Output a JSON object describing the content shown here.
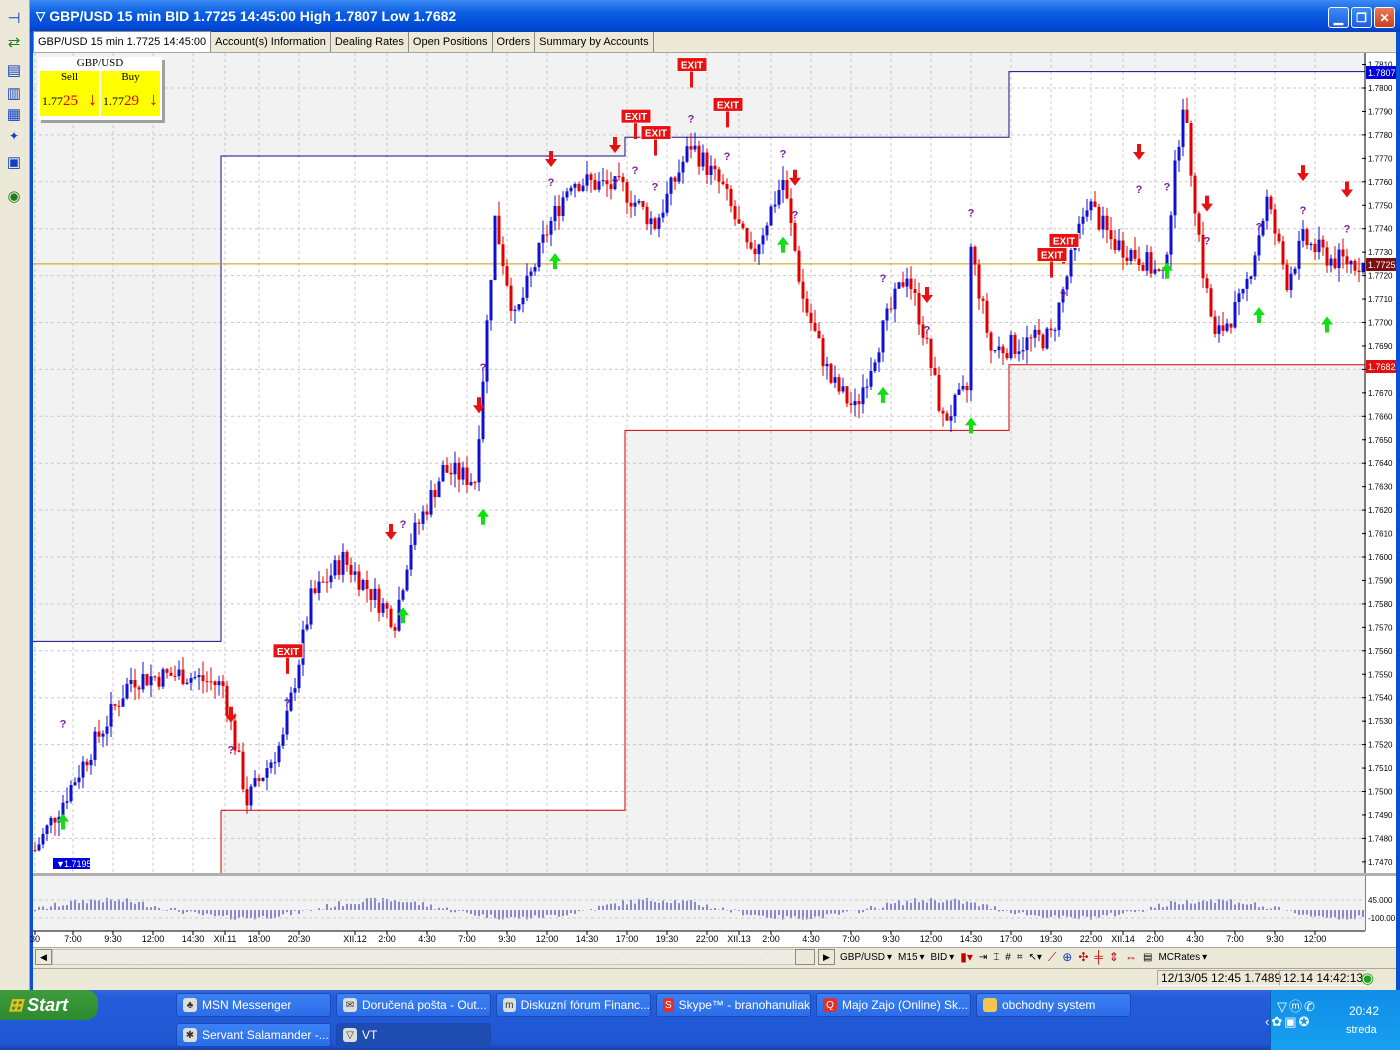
{
  "window": {
    "title": "GBP/USD 15 min BID 1.7725 14:45:00 High 1.7807 Low 1.7682",
    "controls": [
      "minimize",
      "maximize",
      "close"
    ]
  },
  "tabs": [
    {
      "label": "GBP/USD 15 min 1.7725 14:45:00",
      "active": true
    },
    {
      "label": "Account(s) Information"
    },
    {
      "label": "Dealing Rates"
    },
    {
      "label": "Open Positions"
    },
    {
      "label": "Orders"
    },
    {
      "label": "Summary by Accounts"
    }
  ],
  "quote": {
    "symbol": "GBP/USD",
    "sell_label": "Sell",
    "buy_label": "Buy",
    "sell_prefix": "1.77",
    "sell_pips": "25",
    "buy_prefix": "1.77",
    "buy_pips": "29",
    "arrow": "↓"
  },
  "left_toolbar": [
    "pin-icon",
    "swap-icon",
    "layout-rows-icon",
    "layout-cols-icon",
    "layout-grid-icon",
    "new-chart-icon",
    "print-icon",
    "connection-icon"
  ],
  "chart_data": {
    "type": "candlestick",
    "symbol": "GBP/USD",
    "timeframe": "15 min",
    "side": "BID",
    "ylim": [
      1.7465,
      1.7815
    ],
    "yticks": [
      1.781,
      1.78,
      1.779,
      1.778,
      1.777,
      1.776,
      1.775,
      1.774,
      1.773,
      1.772,
      1.771,
      1.77,
      1.769,
      1.768,
      1.767,
      1.766,
      1.765,
      1.764,
      1.763,
      1.762,
      1.761,
      1.76,
      1.759,
      1.758,
      1.757,
      1.756,
      1.755,
      1.754,
      1.753,
      1.752,
      1.751,
      1.75,
      1.749,
      1.748,
      1.747
    ],
    "price_flags": {
      "high": "1.7807",
      "current": "1.7725",
      "low": "1.7682",
      "min_label": "1.7195"
    },
    "current_price": 1.7725,
    "colors": {
      "up": "#1010d0",
      "down": "#e00000",
      "resistance": "#101080",
      "support": "#d00000",
      "current_line": "#c8a000"
    },
    "close_path": [
      [
        0,
        1.7475
      ],
      [
        7,
        1.7496
      ],
      [
        14,
        1.7518
      ],
      [
        24,
        1.7548
      ],
      [
        37,
        1.755
      ],
      [
        47,
        1.7545
      ],
      [
        53,
        1.7496
      ],
      [
        62,
        1.7522
      ],
      [
        69,
        1.7582
      ],
      [
        77,
        1.7599
      ],
      [
        90,
        1.7573
      ],
      [
        94,
        1.7607
      ],
      [
        102,
        1.7637
      ],
      [
        110,
        1.7633
      ],
      [
        115,
        1.7744
      ],
      [
        120,
        1.7701
      ],
      [
        128,
        1.7739
      ],
      [
        134,
        1.7761
      ],
      [
        147,
        1.7757
      ],
      [
        155,
        1.7742
      ],
      [
        164,
        1.7776
      ],
      [
        172,
        1.7757
      ],
      [
        179,
        1.7727
      ],
      [
        187,
        1.7761
      ],
      [
        192,
        1.771
      ],
      [
        199,
        1.7675
      ],
      [
        205,
        1.7663
      ],
      [
        212,
        1.7697
      ],
      [
        218,
        1.7722
      ],
      [
        222,
        1.7697
      ],
      [
        227,
        1.7658
      ],
      [
        233,
        1.7671
      ],
      [
        234,
        1.7731
      ],
      [
        239,
        1.7688
      ],
      [
        254,
        1.7694
      ],
      [
        263,
        1.7752
      ],
      [
        269,
        1.7735
      ],
      [
        277,
        1.7727
      ],
      [
        282,
        1.7718
      ],
      [
        287,
        1.7795
      ],
      [
        292,
        1.7722
      ],
      [
        295,
        1.7693
      ],
      [
        302,
        1.771
      ],
      [
        308,
        1.7752
      ],
      [
        313,
        1.7718
      ],
      [
        317,
        1.7735
      ],
      [
        324,
        1.7727
      ],
      [
        332,
        1.7725
      ]
    ],
    "resistance_steps": [
      [
        0,
        47,
        1.7564
      ],
      [
        47,
        148,
        1.7771
      ],
      [
        148,
        244,
        1.7779
      ],
      [
        244,
        333,
        1.7807
      ]
    ],
    "support_steps": [
      [
        47,
        148,
        1.7492
      ],
      [
        148,
        244,
        1.7654
      ],
      [
        244,
        333,
        1.7682
      ]
    ],
    "sell_signals": [
      [
        49,
        1.7531
      ],
      [
        89,
        1.7609
      ],
      [
        111,
        1.7663
      ],
      [
        129,
        1.7768
      ],
      [
        145,
        1.7774
      ],
      [
        190,
        1.776
      ],
      [
        223,
        1.771
      ],
      [
        276,
        1.7771
      ],
      [
        293,
        1.7749
      ],
      [
        317,
        1.7762
      ],
      [
        328,
        1.7755
      ]
    ],
    "buy_signals": [
      [
        7,
        1.7488
      ],
      [
        92,
        1.7576
      ],
      [
        112,
        1.7618
      ],
      [
        130,
        1.7727
      ],
      [
        187,
        1.7734
      ],
      [
        212,
        1.767
      ],
      [
        234,
        1.7657
      ],
      [
        283,
        1.7723
      ],
      [
        306,
        1.7704
      ],
      [
        323,
        1.77
      ]
    ],
    "exit_label": "EXIT",
    "exit_signals": [
      [
        63,
        1.756
      ],
      [
        164,
        1.781
      ],
      [
        150,
        1.7788
      ],
      [
        155,
        1.7781
      ],
      [
        173,
        1.7793
      ],
      [
        257,
        1.7735
      ],
      [
        254,
        1.7729
      ]
    ],
    "question_label": "?",
    "question_marks": [
      [
        7,
        1.7529
      ],
      [
        49,
        1.7518
      ],
      [
        63,
        1.7538
      ],
      [
        92,
        1.7614
      ],
      [
        112,
        1.7681
      ],
      [
        129,
        1.776
      ],
      [
        145,
        1.776
      ],
      [
        150,
        1.7765
      ],
      [
        155,
        1.7758
      ],
      [
        164,
        1.7787
      ],
      [
        173,
        1.7771
      ],
      [
        187,
        1.7772
      ],
      [
        190,
        1.7746
      ],
      [
        212,
        1.7719
      ],
      [
        223,
        1.7697
      ],
      [
        234,
        1.7747
      ],
      [
        257,
        1.7712
      ],
      [
        276,
        1.7757
      ],
      [
        283,
        1.7758
      ],
      [
        293,
        1.7735
      ],
      [
        306,
        1.7741
      ],
      [
        317,
        1.7748
      ],
      [
        328,
        1.774
      ]
    ],
    "xticks": [
      [
        "30",
        0
      ],
      [
        "7:00",
        9.5
      ],
      [
        "9:30",
        19.5
      ],
      [
        "12:00",
        29.5
      ],
      [
        "14:30",
        39.5
      ],
      [
        "XII.11",
        47.5
      ],
      [
        "18:00",
        56
      ],
      [
        "20:30",
        66
      ],
      [
        "XII.12",
        80
      ],
      [
        "2:00",
        88
      ],
      [
        "4:30",
        98
      ],
      [
        "7:00",
        108
      ],
      [
        "9:30",
        118
      ],
      [
        "12:00",
        128
      ],
      [
        "14:30",
        138
      ],
      [
        "17:00",
        148
      ],
      [
        "19:30",
        158
      ],
      [
        "22:00",
        168
      ],
      [
        "XII.13",
        176
      ],
      [
        "2:00",
        184
      ],
      [
        "4:30",
        194
      ],
      [
        "7:00",
        204
      ],
      [
        "9:30",
        214
      ],
      [
        "12:00",
        224
      ],
      [
        "14:30",
        234
      ],
      [
        "17:00",
        244
      ],
      [
        "19:30",
        254
      ],
      [
        "22:00",
        264
      ],
      [
        "XII.14",
        272
      ],
      [
        "2:00",
        280
      ],
      [
        "4:30",
        290
      ],
      [
        "7:00",
        300
      ],
      [
        "9:30",
        310
      ],
      [
        "12:00",
        320
      ]
    ],
    "indicator": {
      "labels": [
        "45.000",
        "-100.00"
      ]
    }
  },
  "bottom_toolbar": {
    "symbol": "GBP/USD",
    "period": "M15",
    "side": "BID",
    "feed": "MCRates"
  },
  "status": {
    "cursor_info": "12/13/05 12:45  1.7489",
    "server_time": "12.14 14:42:13"
  },
  "taskbar": {
    "start": "Start",
    "items": [
      {
        "label": "MSN Messenger"
      },
      {
        "label": "Doručená pošta - Out..."
      },
      {
        "label": "Diskuzní fórum Financ..."
      },
      {
        "label": "Skype™ - branohanuliak"
      },
      {
        "label": "Majo Zajo (Online) Sk..."
      },
      {
        "label": "obchodny system"
      },
      {
        "label": "Servant Salamander -..."
      },
      {
        "label": "VT",
        "active": true
      }
    ],
    "clock": "20:42",
    "day": "streda"
  }
}
